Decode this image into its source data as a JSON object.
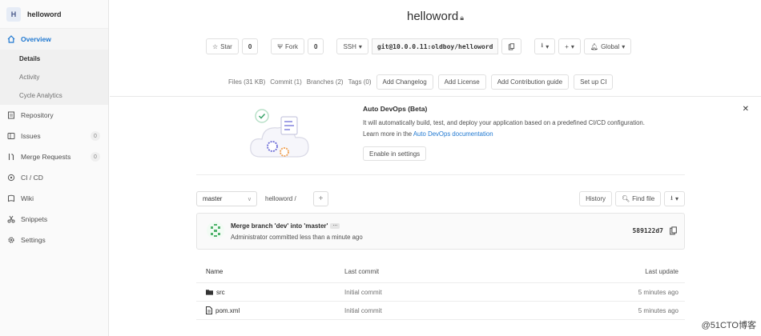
{
  "sidebar": {
    "avatar_letter": "H",
    "project_name": "helloword",
    "items": [
      {
        "label": "Overview",
        "icon": "home-icon"
      },
      {
        "label": "Repository",
        "icon": "document-icon"
      },
      {
        "label": "Issues",
        "icon": "issues-icon",
        "count": "0"
      },
      {
        "label": "Merge Requests",
        "icon": "merge-request-icon",
        "count": "0"
      },
      {
        "label": "CI / CD",
        "icon": "rocket-icon"
      },
      {
        "label": "Wiki",
        "icon": "book-icon"
      },
      {
        "label": "Snippets",
        "icon": "scissors-icon"
      },
      {
        "label": "Settings",
        "icon": "gear-icon"
      }
    ],
    "subitems": [
      {
        "label": "Details"
      },
      {
        "label": "Activity"
      },
      {
        "label": "Cycle Analytics"
      }
    ]
  },
  "header": {
    "title": "helloword",
    "star_label": "Star",
    "star_count": "0",
    "fork_label": "Fork",
    "fork_count": "0",
    "protocol": "SSH",
    "clone_url": "git@10.0.0.11:oldboy/helloword",
    "global_label": "Global"
  },
  "stats": {
    "files": "Files (31 KB)",
    "commits": "Commit (1)",
    "branches": "Branches (2)",
    "tags": "Tags (0)",
    "add_changelog": "Add Changelog",
    "add_license": "Add License",
    "add_contrib": "Add Contribution guide",
    "setup_ci": "Set up CI"
  },
  "devops": {
    "title": "Auto DevOps (Beta)",
    "line1": "It will automatically build, test, and deploy your application based on a predefined CI/CD configuration.",
    "line2_prefix": "Learn more in the ",
    "line2_link": "Auto DevOps documentation",
    "enable_label": "Enable in settings"
  },
  "tree": {
    "branch": "master",
    "path": "helloword /",
    "history": "History",
    "find_file": "Find file"
  },
  "commit": {
    "title": "Merge branch 'dev' into 'master'",
    "subtitle": "Administrator committed less than a minute ago",
    "sha": "589122d7"
  },
  "files": {
    "headers": {
      "name": "Name",
      "last_commit": "Last commit",
      "last_update": "Last update"
    },
    "rows": [
      {
        "name": "src",
        "type": "folder-icon",
        "commit": "Initial commit",
        "updated": "5 minutes ago"
      },
      {
        "name": "pom.xml",
        "type": "file-icon",
        "commit": "Initial commit",
        "updated": "5 minutes ago"
      }
    ]
  },
  "watermark": "@51CTO博客",
  "colors": {
    "accent": "#1f78d1",
    "sidebar_bg": "#fafafa"
  }
}
